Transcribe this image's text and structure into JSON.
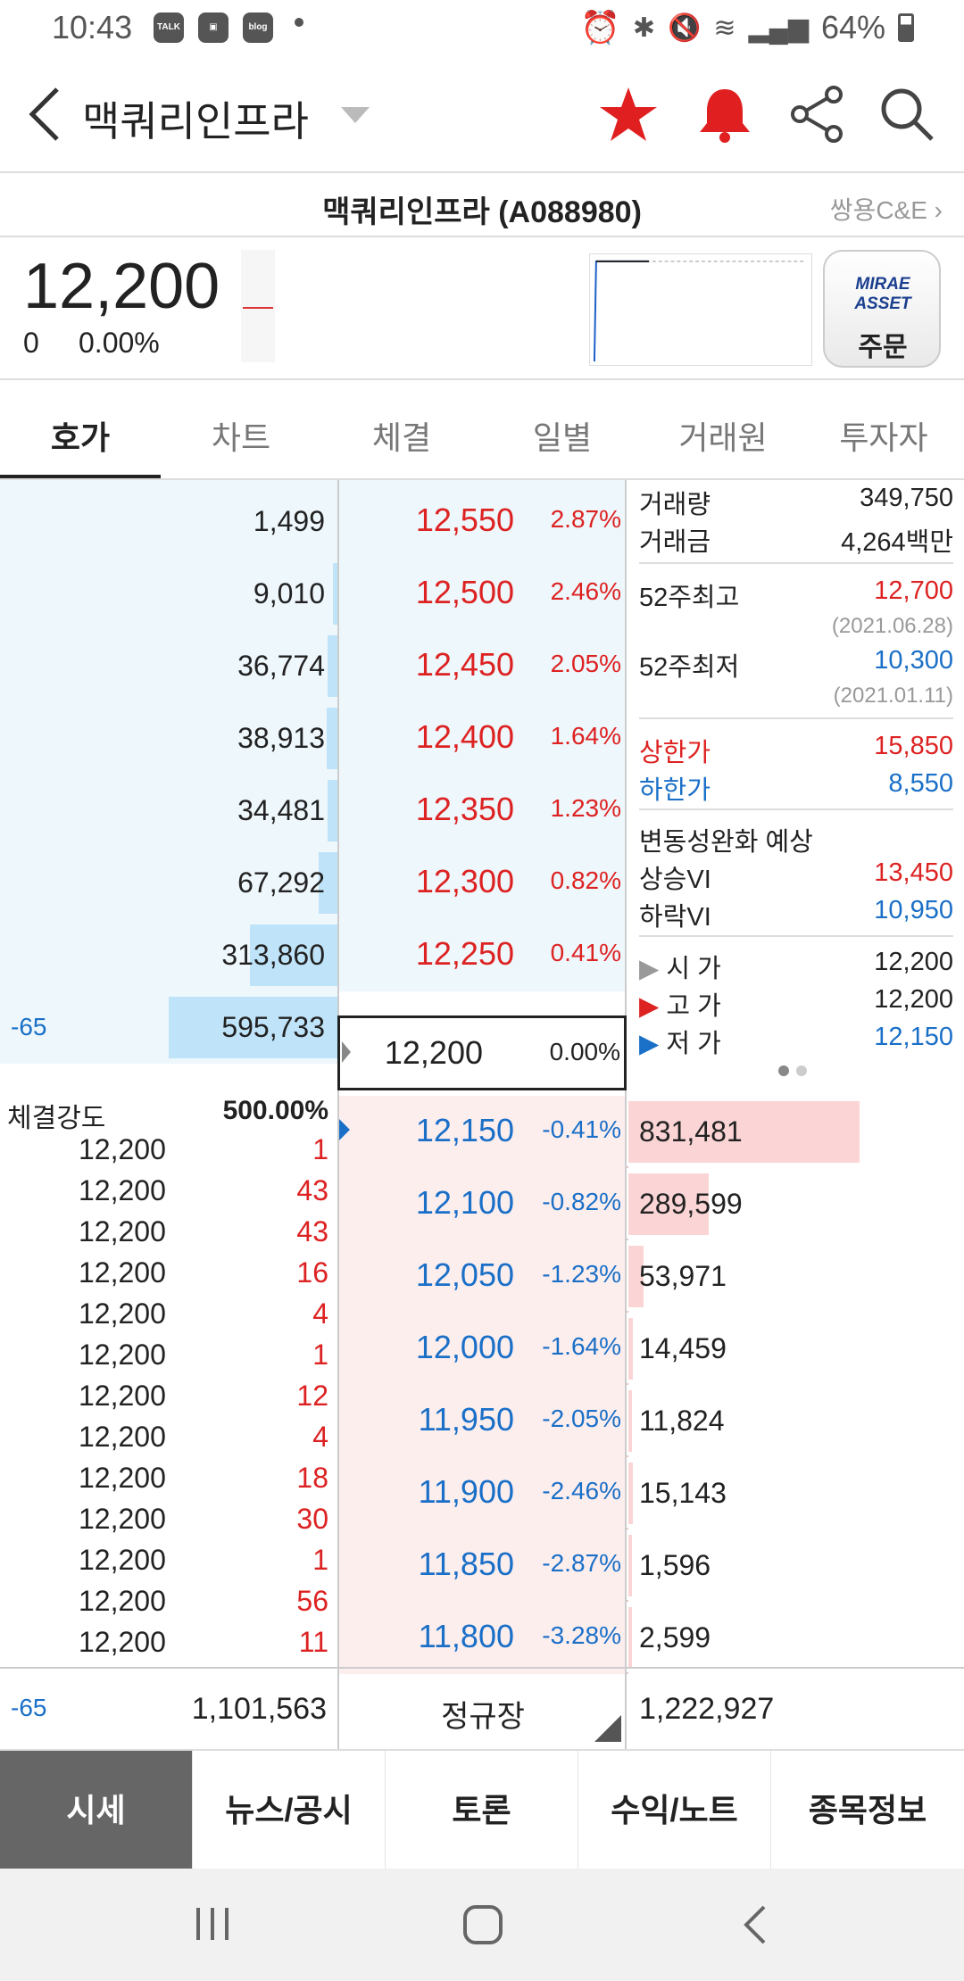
{
  "status_bar": {
    "time": "10:43",
    "battery": "64%",
    "notifications": [
      "TALK",
      "gallery",
      "blog"
    ]
  },
  "header": {
    "title": "맥쿼리인프라",
    "icons": [
      "back-icon",
      "dropdown-caret-icon",
      "star-icon",
      "bell-icon",
      "share-icon",
      "search-icon"
    ]
  },
  "sub_header": {
    "code": "맥쿼리인프라 (A088980)",
    "link": "쌍용C&E"
  },
  "quote": {
    "price": "12,200",
    "change": "0",
    "change_pct": "0.00%"
  },
  "order_button": {
    "brand_line1": "MIRAE",
    "brand_line2": "ASSET",
    "label": "주문"
  },
  "tabs": [
    "호가",
    "차트",
    "체결",
    "일별",
    "거래원",
    "투자자"
  ],
  "asks": [
    {
      "qty": "1,499",
      "price": "12,550",
      "pct": "2.87%",
      "bar": 0.0
    },
    {
      "qty": "9,010",
      "price": "12,500",
      "pct": "2.46%",
      "bar": 0.012
    },
    {
      "qty": "36,774",
      "price": "12,450",
      "pct": "2.05%",
      "bar": 0.03
    },
    {
      "qty": "38,913",
      "price": "12,400",
      "pct": "1.64%",
      "bar": 0.032
    },
    {
      "qty": "34,481",
      "price": "12,350",
      "pct": "1.23%",
      "bar": 0.028
    },
    {
      "qty": "67,292",
      "price": "12,300",
      "pct": "0.82%",
      "bar": 0.056
    },
    {
      "qty": "313,860",
      "price": "12,250",
      "pct": "0.41%",
      "bar": 0.26
    },
    {
      "qty": "595,733",
      "price": "12,200",
      "pct": "0.00%",
      "bar": 0.5,
      "note": "-65"
    }
  ],
  "bids": [
    {
      "price": "12,150",
      "pct": "-0.41%",
      "qty": "831,481",
      "bar": 0.69
    },
    {
      "price": "12,100",
      "pct": "-0.82%",
      "qty": "289,599",
      "bar": 0.24
    },
    {
      "price": "12,050",
      "pct": "-1.23%",
      "qty": "53,971",
      "bar": 0.045
    },
    {
      "price": "12,000",
      "pct": "-1.64%",
      "qty": "14,459",
      "bar": 0.012
    },
    {
      "price": "11,950",
      "pct": "-2.05%",
      "qty": "11,824",
      "bar": 0.01
    },
    {
      "price": "11,900",
      "pct": "-2.46%",
      "qty": "15,143",
      "bar": 0.013
    },
    {
      "price": "11,850",
      "pct": "-2.87%",
      "qty": "1,596",
      "bar": 0.0
    },
    {
      "price": "11,800",
      "pct": "-3.28%",
      "qty": "2,599",
      "bar": 0.0
    }
  ],
  "info": {
    "volume_label": "거래량",
    "volume": "349,750",
    "amount_label": "거래금",
    "amount": "4,264백만",
    "high52_label": "52주최고",
    "high52": "12,700",
    "high52_date": "(2021.06.28)",
    "low52_label": "52주최저",
    "low52": "10,300",
    "low52_date": "(2021.01.11)",
    "upper_label": "상한가",
    "upper": "15,850",
    "lower_label": "하한가",
    "lower": "8,550",
    "vi_title": "변동성완화 예상",
    "vi_up_label": "상승VI",
    "vi_up": "13,450",
    "vi_down_label": "하락VI",
    "vi_down": "10,950",
    "open_label": "시 가",
    "open": "12,200",
    "high_label": "고 가",
    "high": "12,200",
    "low_label": "저 가",
    "low": "12,150"
  },
  "execution": {
    "strength_label": "체결강도",
    "strength": "500.00%",
    "rows": [
      {
        "price": "12,200",
        "qty": "1"
      },
      {
        "price": "12,200",
        "qty": "43"
      },
      {
        "price": "12,200",
        "qty": "43"
      },
      {
        "price": "12,200",
        "qty": "16"
      },
      {
        "price": "12,200",
        "qty": "4"
      },
      {
        "price": "12,200",
        "qty": "1"
      },
      {
        "price": "12,200",
        "qty": "12"
      },
      {
        "price": "12,200",
        "qty": "4"
      },
      {
        "price": "12,200",
        "qty": "18"
      },
      {
        "price": "12,200",
        "qty": "30"
      },
      {
        "price": "12,200",
        "qty": "1"
      },
      {
        "price": "12,200",
        "qty": "56"
      },
      {
        "price": "12,200",
        "qty": "11"
      }
    ]
  },
  "footer": {
    "diff": "-65",
    "ask_total": "1,101,563",
    "session": "정규장",
    "bid_total": "1,222,927"
  },
  "bottom_nav": [
    "시세",
    "뉴스/공시",
    "토론",
    "수익/노트",
    "종목정보"
  ],
  "colors": {
    "up": "#d22222",
    "down": "#1a6fc7",
    "ask_bg": "#eef7fc",
    "bid_bg": "#fdeeee",
    "ask_bar": "#bfe3f8",
    "bid_bar": "#fbd5d5"
  }
}
